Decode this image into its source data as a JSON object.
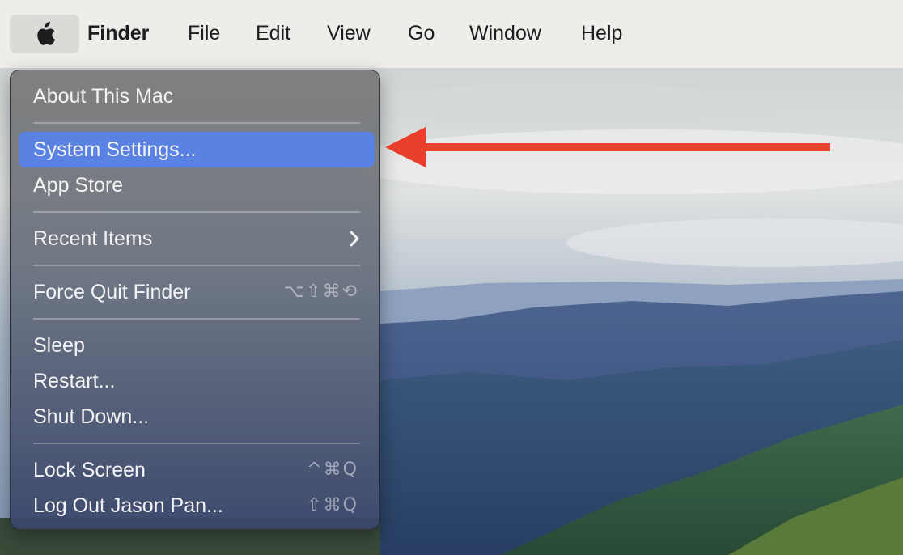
{
  "menubar": {
    "apple_icon": "apple-logo-icon",
    "items": [
      "Finder",
      "File",
      "Edit",
      "View",
      "Go",
      "Window",
      "Help"
    ]
  },
  "apple_menu": {
    "about": "About This Mac",
    "system_settings": "System Settings...",
    "app_store": "App Store",
    "recent_items": "Recent Items",
    "force_quit": "Force Quit Finder",
    "force_quit_shortcut": "⌥⇧⌘⟲",
    "sleep": "Sleep",
    "restart": "Restart...",
    "shut_down": "Shut Down...",
    "lock_screen": "Lock Screen",
    "lock_screen_shortcut": "^⌘Q",
    "log_out": "Log Out Jason Pan...",
    "log_out_shortcut": "⇧⌘Q"
  },
  "annotation": {
    "arrow_color": "#e8402a",
    "arrow_icon": "left-arrow-icon"
  },
  "colors": {
    "highlight": "#5a82e2",
    "menubar": "#efedea"
  }
}
